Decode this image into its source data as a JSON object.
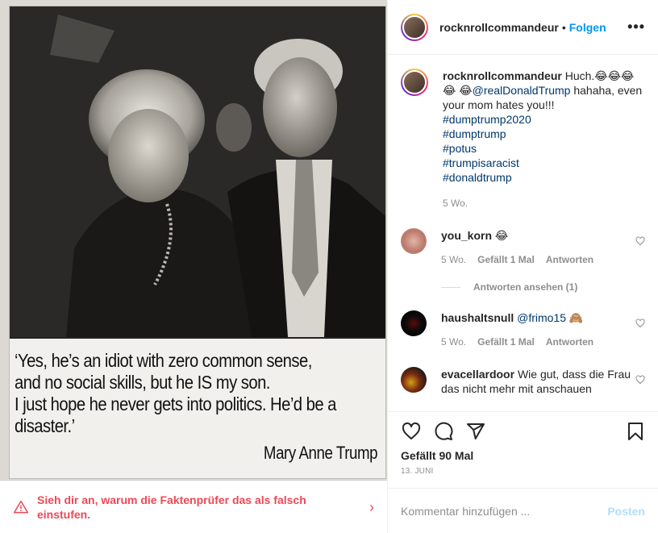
{
  "post": {
    "quote": {
      "lines": [
        "‘Yes, he’s an idiot with zero common sense,",
        "and no social skills, but he IS my son.",
        "I just hope he never gets into politics. He’d be a",
        "disaster.’"
      ],
      "author": "Mary Anne Trump"
    }
  },
  "factcheck": {
    "text": "Sieh dir an, warum die Faktenprüfer das als falsch einstufen.",
    "icon": "warning-triangle-icon",
    "color": "#ed4956"
  },
  "header": {
    "username": "rocknrollcommandeur",
    "separator": "•",
    "follow_label": "Folgen",
    "more_label": "•••"
  },
  "caption": {
    "username": "rocknrollcommandeur",
    "text_start": "Huch.😂😂😂😂",
    "text_emoji2": "😂",
    "mention": "@realDonaldTrump",
    "text_end": " hahaha, even your mom hates you!!!",
    "hashtags": [
      "#dumptrump2020",
      "#dumptrump",
      "#potus",
      "#trumpisaracist",
      "#donaldtrump"
    ],
    "time": "5 Wo."
  },
  "comments": [
    {
      "username": "you_korn",
      "text": "😂",
      "time": "5 Wo.",
      "likes": "Gefällt 1 Mal",
      "reply": "Antworten",
      "view_replies": "Antworten ansehen (1)"
    },
    {
      "username": "haushaltsnull",
      "mention": "@frimo15",
      "text": "🙈",
      "time": "5 Wo.",
      "likes": "Gefällt 1 Mal",
      "reply": "Antworten"
    },
    {
      "username": "evacellardoor",
      "text": "Wie gut, dass die Frau das nicht mehr mit anschauen"
    }
  ],
  "actions": {
    "likes": "Gefällt 90 Mal",
    "date": "13. JUNI"
  },
  "add_comment": {
    "placeholder": "Kommentar hinzufügen ...",
    "post_label": "Posten"
  },
  "colors": {
    "link": "#00376b",
    "follow": "#0095f6",
    "muted": "#8e8e8e",
    "post_disabled": "#b2dffc"
  }
}
